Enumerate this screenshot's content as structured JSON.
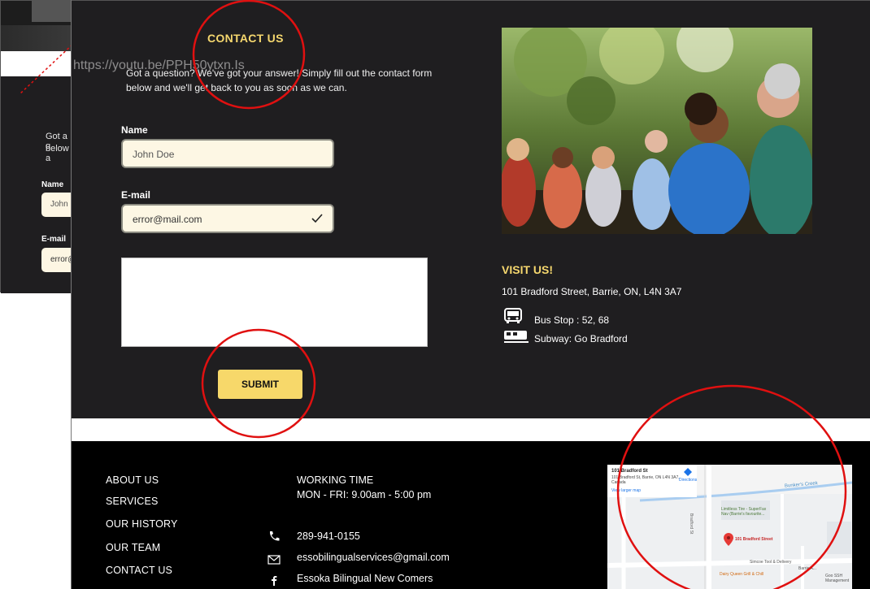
{
  "background_page": {
    "intro_line1": "Got a q",
    "intro_line2": "below a",
    "name_label": "Name",
    "name_value": "John",
    "email_label": "E-mail",
    "email_value": "error@"
  },
  "overlay_url": "https://youtu.be/PPH50ytxn.Is",
  "contact": {
    "title": "CONTACT US",
    "intro_line1": "Got a question? We've got your answer! Simply fill out the contact form",
    "intro_line2": "below and we'll get back to you as soon as we can.",
    "name_label": "Name",
    "name_placeholder": "John Doe",
    "email_label": "E-mail",
    "email_value": "error@mail.com",
    "submit_label": "SUBMIT"
  },
  "visit": {
    "title": "VISIT US!",
    "address": "101 Bradford Street, Barrie, ON, L4N 3A7",
    "bus": "Bus Stop : 52, 68",
    "subway": "Subway: Go Bradford"
  },
  "footer": {
    "links": [
      "ABOUT US",
      "SERVICES",
      "OUR HISTORY",
      "OUR TEAM",
      "CONTACT US"
    ],
    "working_title": "WORKING TIME",
    "working_hours": "MON - FRI: 9.00am - 5:00 pm",
    "phone": "289-941-0155",
    "email": "essobilingualservices@gmail.com",
    "facebook": "Essoka Bilingual New Comers"
  },
  "map": {
    "place_title": "101 Bradford St",
    "place_address": "101 Bradford St, Barrie, ON L4N 3A7,",
    "place_country": "Canada",
    "directions": "Directions",
    "view_larger": "View larger map",
    "creek": "Bunker's Creek",
    "street_bradford": "Bradford St",
    "poi_tire": "Limitless Tire - SuperFax",
    "poi_tire2": "Nav (Barrie's favourite...",
    "pin_label": "101 Bradford Street",
    "poi_simcoe": "Simcoe Tool & Delivery",
    "poi_dairy": "Dairy Queen Grill & Chill",
    "poi_misc": "Barrie A...",
    "poi_ssh": "Goo SSH Management"
  },
  "colors": {
    "accent_yellow": "#f5d76e",
    "dark_bg": "#1f1e20",
    "footer_bg": "#000000",
    "annotation_red": "#e01010"
  },
  "icons": [
    "check-icon",
    "bus-icon",
    "subway-icon",
    "phone-icon",
    "mail-icon",
    "facebook-icon",
    "map-pin-icon",
    "directions-icon"
  ]
}
